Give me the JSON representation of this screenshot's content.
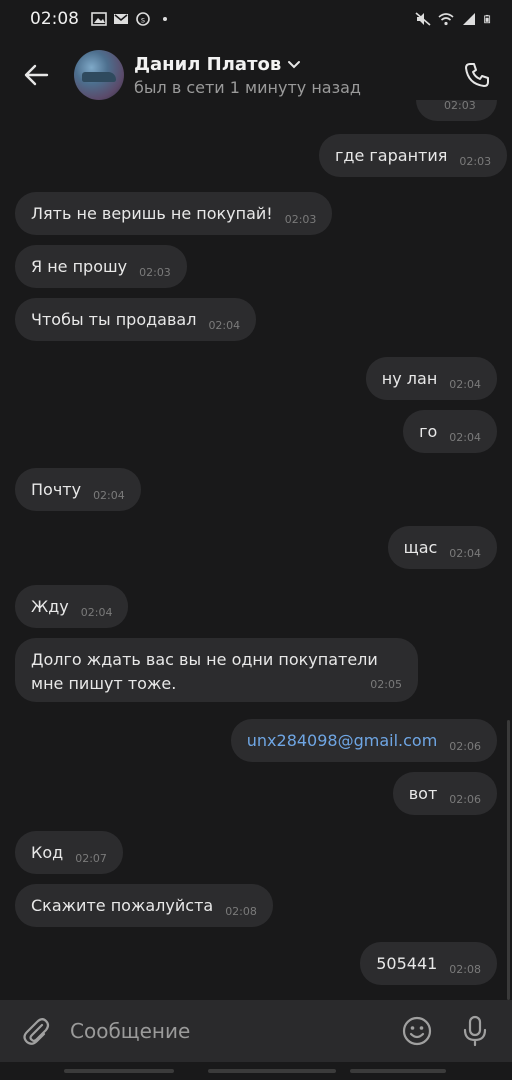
{
  "status_bar": {
    "time": "02:08",
    "left_icons": [
      "image-icon",
      "mail-icon",
      "skype-icon",
      "dot-icon"
    ],
    "right_icons": [
      "mute-icon",
      "wifi-icon",
      "signal-icon",
      "battery-icon"
    ]
  },
  "header": {
    "name": "Данил Платов",
    "status": "был в сети 1 минуту назад"
  },
  "messages": [
    {
      "side": "out",
      "text": "",
      "time": "02:03"
    },
    {
      "side": "out",
      "text": "где гарантия",
      "time": "02:03"
    },
    {
      "side": "in",
      "text": "Лять не веришь не покупай!",
      "time": "02:03"
    },
    {
      "side": "in",
      "text": "Я не прошу",
      "time": "02:03"
    },
    {
      "side": "in",
      "text": "Чтобы ты продавал",
      "time": "02:04"
    },
    {
      "side": "out",
      "text": "ну лан",
      "time": "02:04"
    },
    {
      "side": "out",
      "text": "го",
      "time": "02:04"
    },
    {
      "side": "in",
      "text": "Почту",
      "time": "02:04"
    },
    {
      "side": "out",
      "text": "щас",
      "time": "02:04"
    },
    {
      "side": "in",
      "text": "Жду",
      "time": "02:04"
    },
    {
      "side": "in",
      "text": "Долго ждать вас вы не одни покупатели мне пишут тоже.",
      "time": "02:05"
    },
    {
      "side": "out",
      "text": "unx284098@gmail.com",
      "time": "02:06",
      "link": true
    },
    {
      "side": "out",
      "text": "вот",
      "time": "02:06"
    },
    {
      "side": "in",
      "text": "Код",
      "time": "02:07"
    },
    {
      "side": "in",
      "text": "Скажите пожалуйста",
      "time": "02:08"
    },
    {
      "side": "out",
      "text": "505441",
      "time": "02:08"
    }
  ],
  "composer": {
    "placeholder": "Сообщение"
  },
  "colors": {
    "background": "#19191a",
    "bubble": "#2c2c2e",
    "link": "#6fa6e4"
  }
}
